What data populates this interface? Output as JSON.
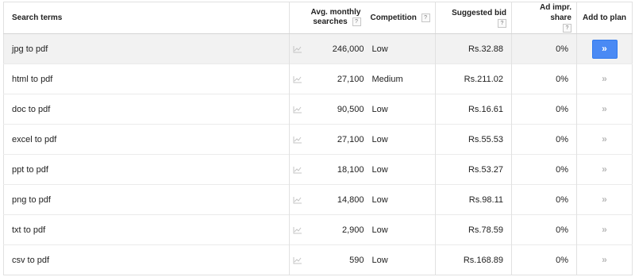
{
  "headers": {
    "term": "Search terms",
    "avg_line1": "Avg. monthly",
    "avg_line2": "searches",
    "competition": "Competition",
    "bid": "Suggested bid",
    "impr": "Ad impr. share",
    "plan": "Add to plan",
    "help": "?"
  },
  "add_icon": "double-chevron-right-icon",
  "trend_icon": "trend-chart-icon",
  "colors": {
    "button": "#4a8af4",
    "row_highlight": "#f2f2f2"
  },
  "rows": [
    {
      "term": "jpg to pdf",
      "searches": "246,000",
      "competition": "Low",
      "bid": "Rs.32.88",
      "impr": "0%",
      "add": "»"
    },
    {
      "term": "html to pdf",
      "searches": "27,100",
      "competition": "Medium",
      "bid": "Rs.211.02",
      "impr": "0%",
      "add": "»"
    },
    {
      "term": "doc to pdf",
      "searches": "90,500",
      "competition": "Low",
      "bid": "Rs.16.61",
      "impr": "0%",
      "add": "»"
    },
    {
      "term": "excel to pdf",
      "searches": "27,100",
      "competition": "Low",
      "bid": "Rs.55.53",
      "impr": "0%",
      "add": "»"
    },
    {
      "term": "ppt to pdf",
      "searches": "18,100",
      "competition": "Low",
      "bid": "Rs.53.27",
      "impr": "0%",
      "add": "»"
    },
    {
      "term": "png to pdf",
      "searches": "14,800",
      "competition": "Low",
      "bid": "Rs.98.11",
      "impr": "0%",
      "add": "»"
    },
    {
      "term": "txt to pdf",
      "searches": "2,900",
      "competition": "Low",
      "bid": "Rs.78.59",
      "impr": "0%",
      "add": "»"
    },
    {
      "term": "csv to pdf",
      "searches": "590",
      "competition": "Low",
      "bid": "Rs.168.89",
      "impr": "0%",
      "add": "»"
    }
  ]
}
